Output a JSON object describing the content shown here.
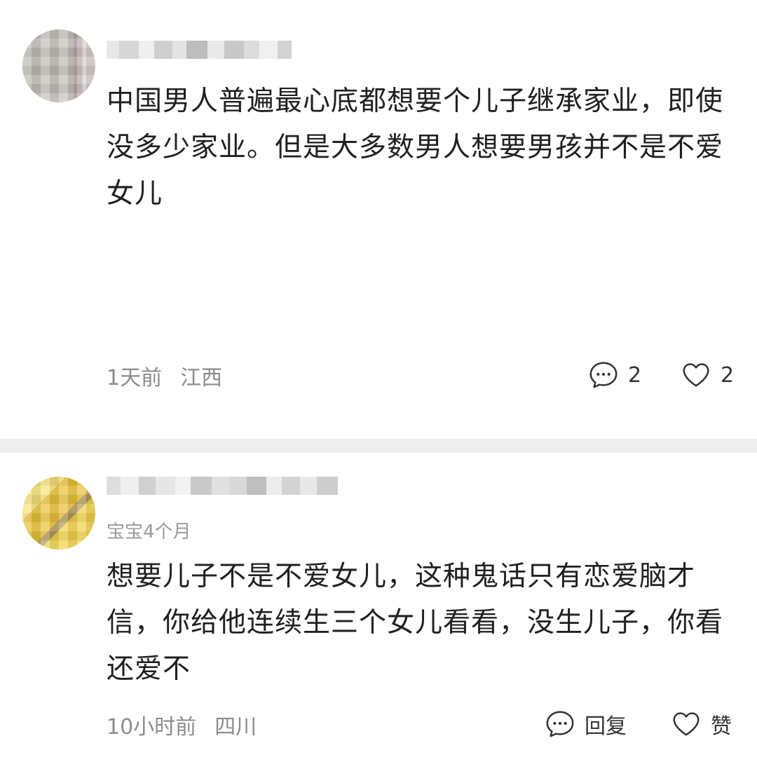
{
  "comments": [
    {
      "tag": "",
      "text": "中国男人普遍最心底都想要个儿子继承家业，即使没多少家业。但是大多数男人想要男孩并不是不爱女儿",
      "time": "1天前",
      "location": "江西",
      "reply_count": "2",
      "like_count": "2"
    },
    {
      "tag": "宝宝4个月",
      "text": "想要儿子不是不爱女儿，这种鬼话只有恋爱脑才信，你给他连续生三个女儿看看，没生儿子，你看还爱不",
      "time": "10小时前",
      "location": "四川",
      "reply_label": "回复",
      "like_label": "赞"
    }
  ],
  "icons": {
    "reply": "chat-bubble-icon",
    "like": "heart-outline-icon"
  },
  "colors": {
    "divider": "#eeeeee",
    "meta_text": "#8c8c8c",
    "body_text": "#202020"
  }
}
